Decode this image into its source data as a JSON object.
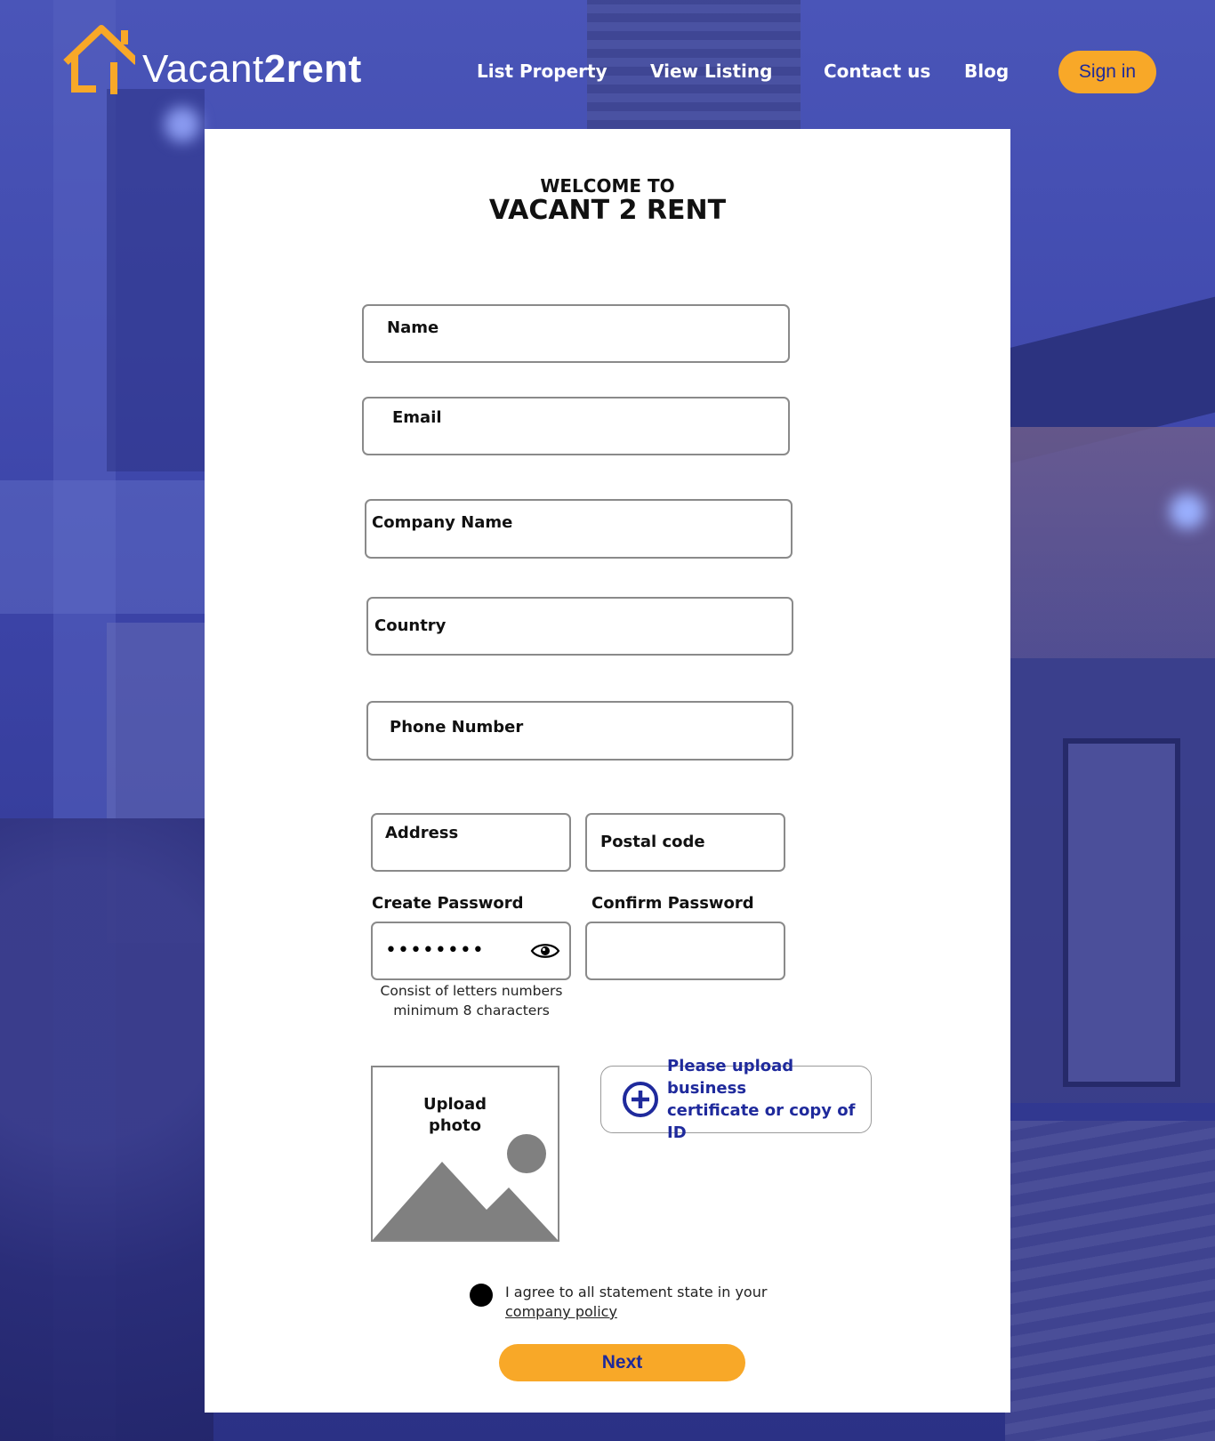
{
  "brand": {
    "name_light": "Vacant",
    "name_bold": "2rent",
    "accent_color": "#f8a828",
    "text_color": "#ffffff"
  },
  "nav": {
    "items": [
      {
        "label": "List Property"
      },
      {
        "label": "View Listing"
      },
      {
        "label": "Contact us"
      },
      {
        "label": "Blog"
      }
    ],
    "signin_label": "Sign in"
  },
  "form": {
    "welcome_small": "WELCOME TO",
    "welcome_big": "VACANT 2 RENT",
    "fields": {
      "name": "Name",
      "email": "Email",
      "company": "Company Name",
      "country": "Country",
      "phone": "Phone Number",
      "address": "Address",
      "postal": "Postal code"
    },
    "password": {
      "create_label": "Create Password",
      "confirm_label": "Confirm Password",
      "masked_value": "••••••••",
      "hint_line1": "Consist of letters numbers",
      "hint_line2": "minimum 8 characters"
    },
    "upload_photo": {
      "line1": "Upload",
      "line2": "photo"
    },
    "upload_cert": {
      "line1": "Please upload business",
      "line2": "certificate or copy of ID"
    },
    "agree": {
      "text": "I agree to all statement state in your",
      "link": "company policy"
    },
    "next_label": "Next"
  },
  "colors": {
    "primary_blue": "#1e2a9a",
    "accent": "#f8a828",
    "background_overlay": "#3a3f9e"
  },
  "icons": [
    "house-logo-icon",
    "eye-icon",
    "image-placeholder-icon",
    "plus-circle-icon"
  ]
}
